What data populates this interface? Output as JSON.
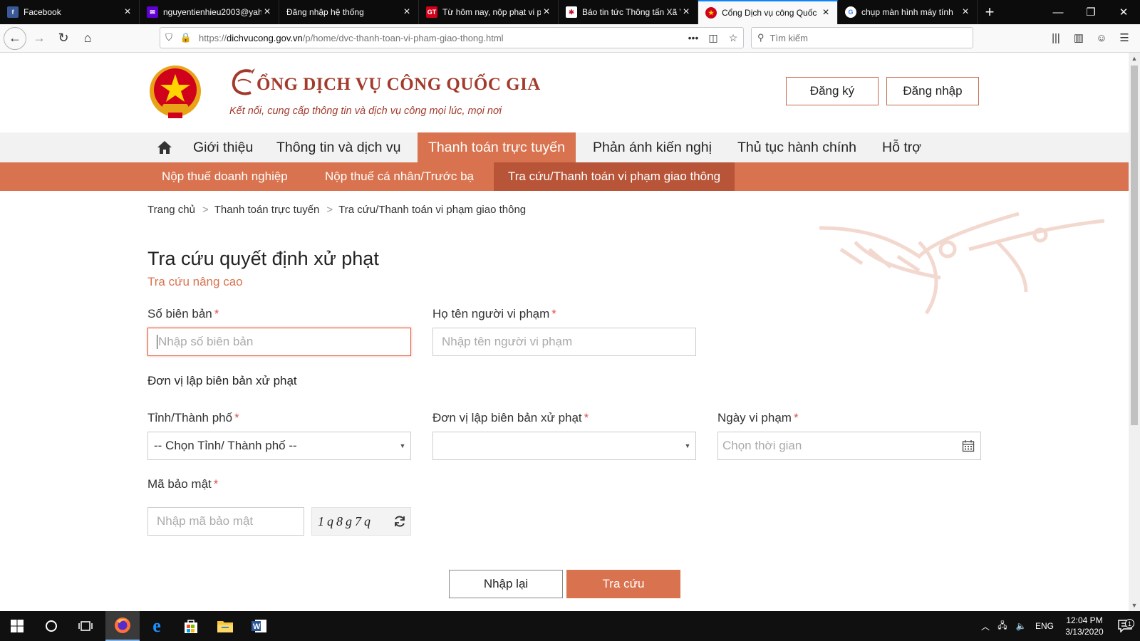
{
  "browser": {
    "tabs": [
      {
        "title": "Facebook",
        "favicon": "facebook-icon",
        "color": "#3b5998",
        "glyph": "f"
      },
      {
        "title": "nguyentienhieu2003@yah",
        "favicon": "yahoo-mail-icon",
        "color": "#6001d2",
        "glyph": "✉"
      },
      {
        "title": "Đăng nhập hệ thống",
        "favicon": "",
        "color": "",
        "glyph": ""
      },
      {
        "title": "Từ hôm nay, nộp phạt vi p",
        "favicon": "gt-news-icon",
        "color": "#d0021b",
        "glyph": "GT"
      },
      {
        "title": "Báo tin tức Thông tấn Xã V",
        "favicon": "news-icon",
        "color": "#c8102e",
        "glyph": "✱"
      },
      {
        "title": "Cổng Dịch vụ công Quốc",
        "favicon": "emblem-icon",
        "color": "#e8a317",
        "glyph": "★"
      },
      {
        "title": "chụp màn hình máy tính",
        "favicon": "google-icon",
        "color": "#4285f4",
        "glyph": "G"
      }
    ],
    "active_tab": 5,
    "url_prefix": "https://",
    "url_domain": "dichvucong.gov.vn",
    "url_path": "/p/home/dvc-thanh-toan-vi-pham-giao-thong.html",
    "search_placeholder": "Tìm kiếm"
  },
  "site": {
    "title": "ỔNG DỊCH VỤ CÔNG QUỐC GIA",
    "tagline": "Kết nối, cung cấp thông tin và dịch vụ công mọi lúc, mọi nơi",
    "register_label": "Đăng ký",
    "login_label": "Đăng nhập"
  },
  "mainnav": {
    "items": [
      "Giới thiệu",
      "Thông tin và dịch vụ",
      "Thanh toán trực tuyến",
      "Phản ánh kiến nghị",
      "Thủ tục hành chính",
      "Hỗ trợ"
    ]
  },
  "subnav": {
    "items": [
      "Nộp thuế doanh nghiệp",
      "Nộp thuế cá nhân/Trước bạ",
      "Tra cứu/Thanh toán vi phạm giao thông"
    ]
  },
  "breadcrumb": [
    "Trang chủ",
    "Thanh toán trực tuyến",
    "Tra cứu/Thanh toán vi phạm giao thông"
  ],
  "form": {
    "title": "Tra cứu quyết định xử phạt",
    "advanced_link": "Tra cứu nâng cao",
    "record_no": {
      "label": "Số biên bản",
      "placeholder": "Nhập số biên bản"
    },
    "violator_name": {
      "label": "Họ tên người vi phạm",
      "placeholder": "Nhập tên người vi phạm"
    },
    "section_title": "Đơn vị lập biên bản xử phạt",
    "province": {
      "label": "Tỉnh/Thành phố",
      "value": "-- Chọn Tỉnh/ Thành phố --"
    },
    "unit": {
      "label": "Đơn vị lập biên bản xử phạt",
      "value": ""
    },
    "date": {
      "label": "Ngày vi phạm",
      "placeholder": "Chọn thời gian"
    },
    "captcha": {
      "label": "Mã bảo mật",
      "placeholder": "Nhập mã bảo mật",
      "code": "1q8g7q"
    },
    "reset_label": "Nhập lại",
    "submit_label": "Tra cứu",
    "required_mark": "*"
  },
  "taskbar": {
    "language": "ENG",
    "time": "12:04 PM",
    "date": "3/13/2020",
    "notifications": "1"
  },
  "colors": {
    "accent": "#d9734f",
    "accent_dark": "#b85539",
    "brand_red": "#a23b2c"
  }
}
